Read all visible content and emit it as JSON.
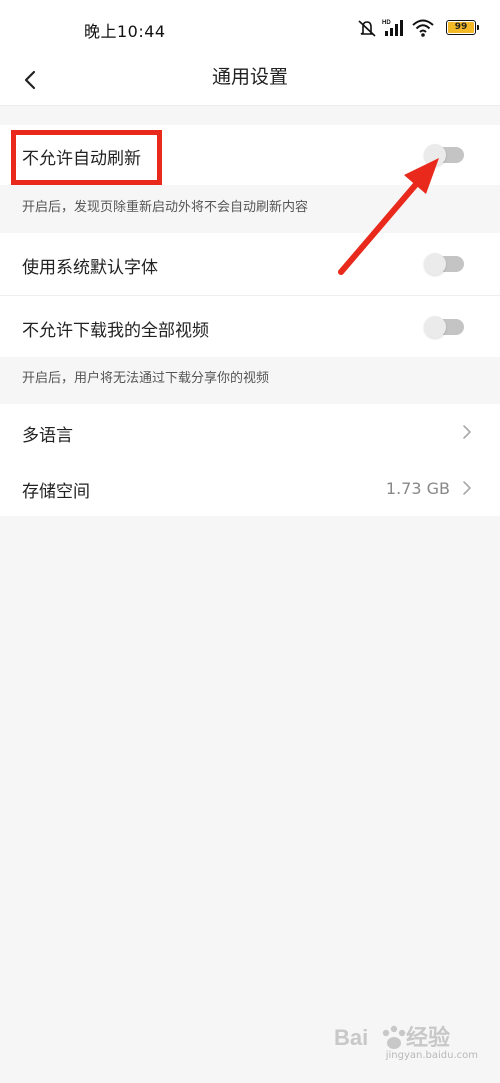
{
  "status_bar": {
    "time": "晚上10:44",
    "battery": "99",
    "icons": [
      "mute-icon",
      "hd-signal-icon",
      "wifi-icon",
      "battery-icon"
    ]
  },
  "nav": {
    "title": "通用设置",
    "back_icon": "chevron-left-icon"
  },
  "settings": {
    "auto_refresh": {
      "label": "不允许自动刷新",
      "enabled": false,
      "description": "开启后，发现页除重新启动外将不会自动刷新内容"
    },
    "system_font": {
      "label": "使用系统默认字体",
      "enabled": false
    },
    "download_videos": {
      "label": "不允许下载我的全部视频",
      "enabled": false,
      "description": "开启后，用户将无法通过下载分享你的视频"
    },
    "language": {
      "label": "多语言"
    },
    "storage": {
      "label": "存储空间",
      "value": "1.73 GB"
    }
  },
  "watermark": {
    "text": "jingyan.baidu.com"
  },
  "colors": {
    "annotation_red": "#e8291c",
    "toggle_track": "#c4c4c4",
    "toggle_knob": "#ebebeb",
    "background": "#f6f6f6",
    "battery": "#f2b826"
  }
}
